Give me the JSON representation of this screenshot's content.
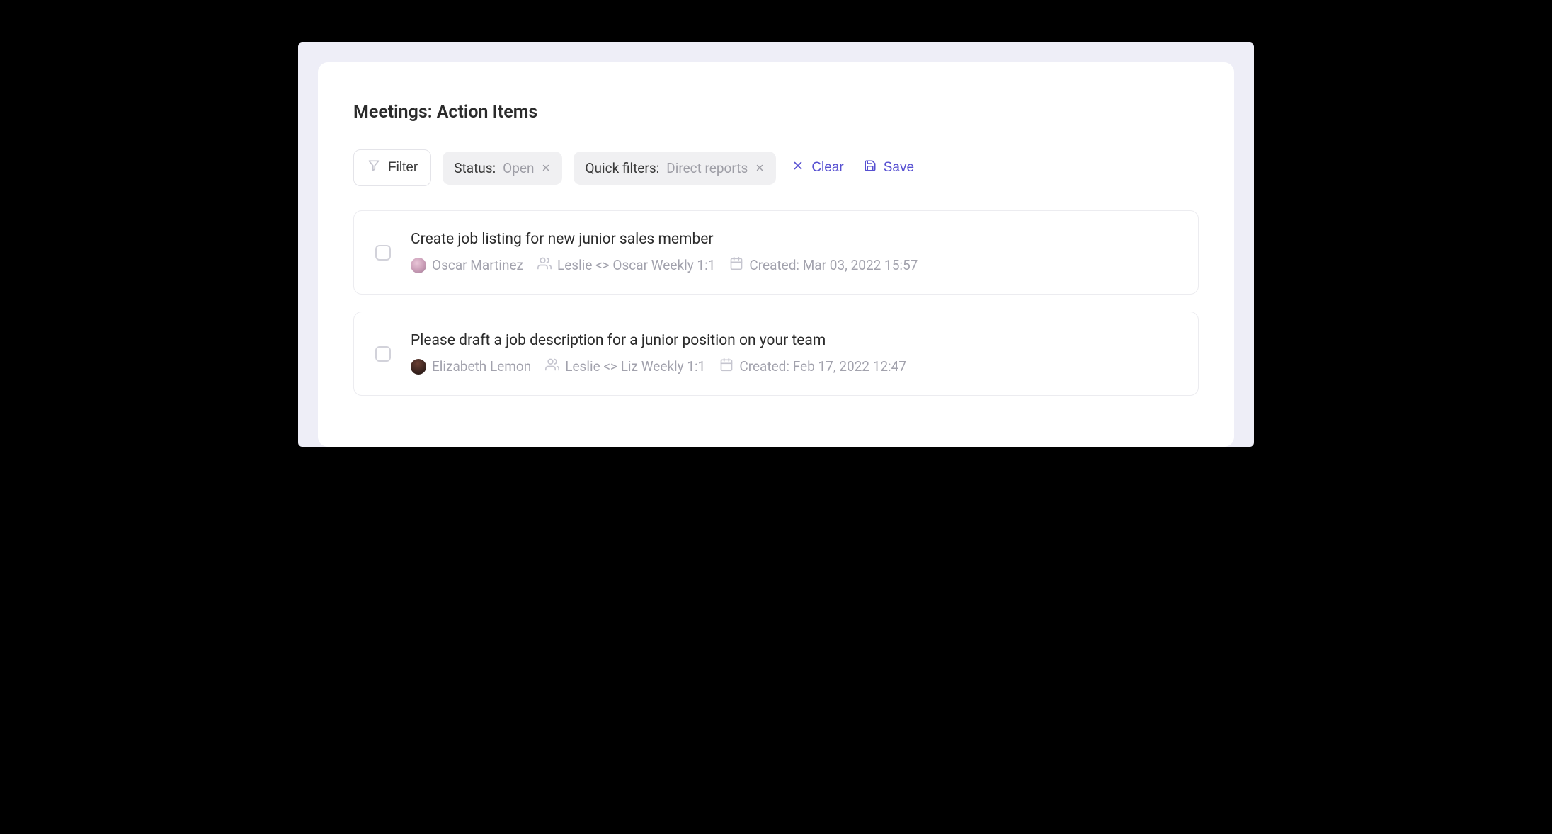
{
  "page_title": "Meetings: Action Items",
  "toolbar": {
    "filter_label": "Filter",
    "clear_label": "Clear",
    "save_label": "Save",
    "chips": [
      {
        "label": "Status:",
        "value": "Open"
      },
      {
        "label": "Quick filters:",
        "value": "Direct reports"
      }
    ]
  },
  "items": [
    {
      "title": "Create job listing for new junior sales member",
      "assignee": "Oscar Martinez",
      "meeting": "Leslie <> Oscar Weekly 1:1",
      "created": "Created: Mar 03, 2022 15:57"
    },
    {
      "title": "Please draft a job description for a junior position on your team",
      "assignee": "Elizabeth Lemon",
      "meeting": "Leslie <> Liz Weekly 1:1",
      "created": "Created: Feb 17, 2022 12:47"
    }
  ]
}
